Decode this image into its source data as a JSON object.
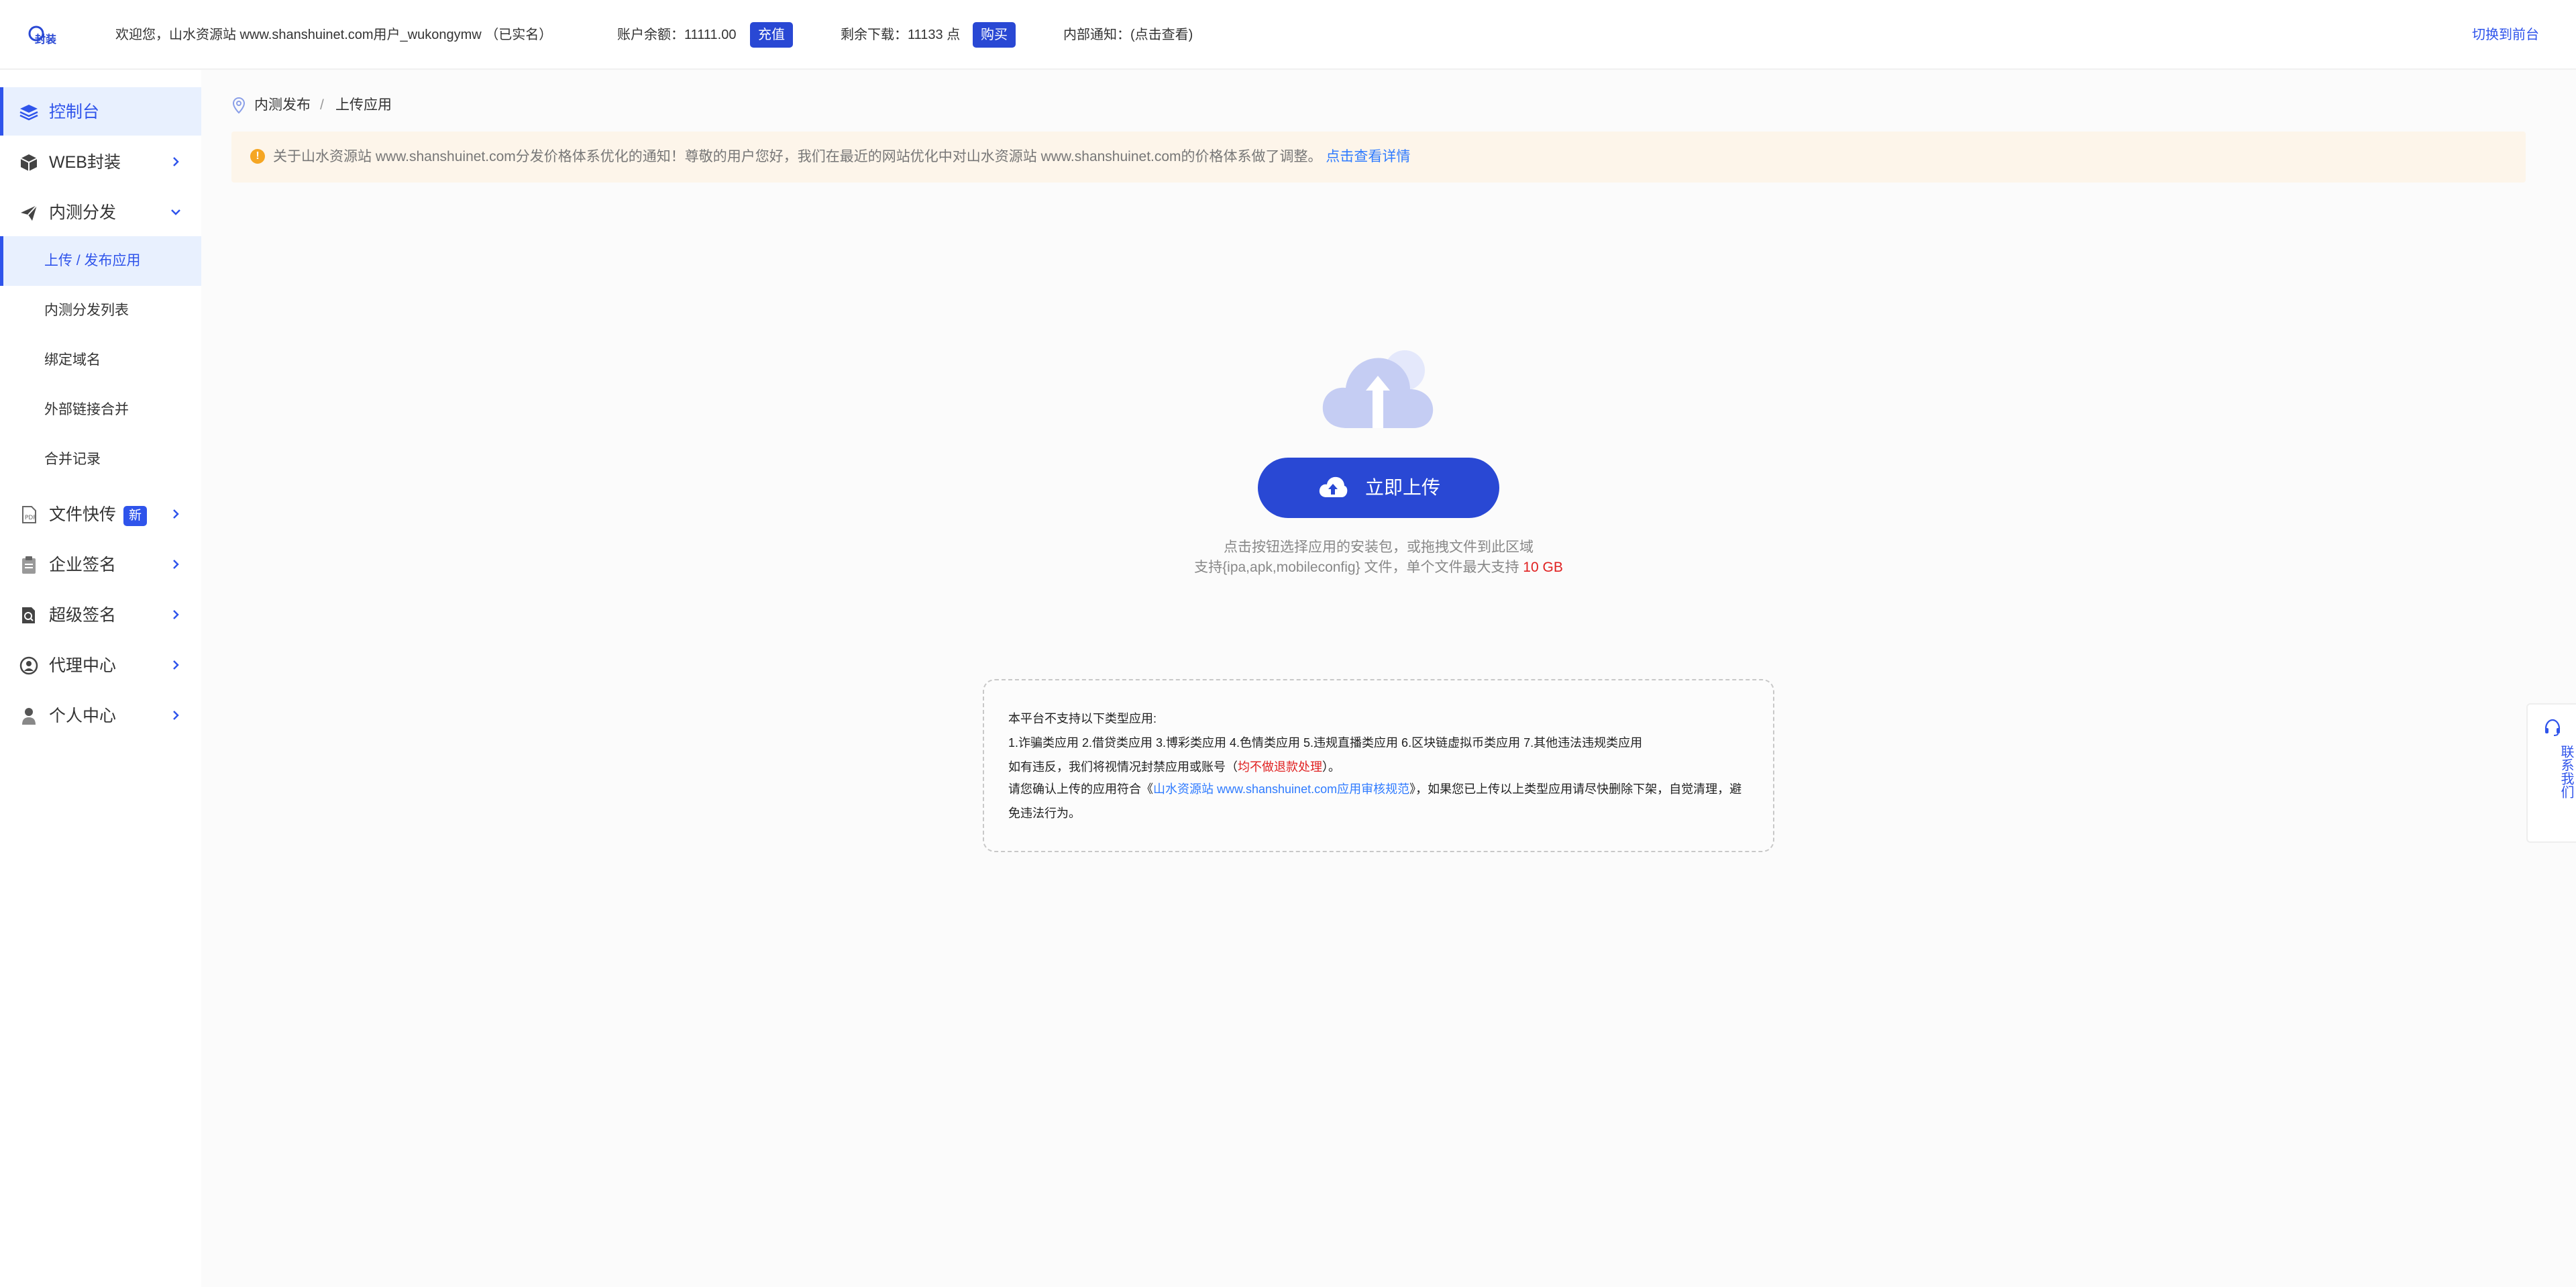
{
  "header": {
    "welcome": "欢迎您，山水资源站 www.shanshuinet.com用户_wukongymw （已实名）",
    "balance_label": "账户余额：11111.00",
    "recharge_button": "充值",
    "downloads_label": "剩余下载：11133 点",
    "buy_button": "购买",
    "notice_label": "内部通知：(点击查看)",
    "switch_link": "切换到前台"
  },
  "sidebar": {
    "items": [
      {
        "label": "控制台",
        "icon": "layers-icon"
      },
      {
        "label": "WEB封装",
        "icon": "box-icon"
      },
      {
        "label": "内测分发",
        "icon": "paper-plane-icon"
      },
      {
        "label": "文件快传",
        "icon": "file-icon",
        "badge": "新"
      },
      {
        "label": "企业签名",
        "icon": "clipboard-icon"
      },
      {
        "label": "超级签名",
        "icon": "document-search-icon"
      },
      {
        "label": "代理中心",
        "icon": "agent-icon"
      },
      {
        "label": "个人中心",
        "icon": "user-icon"
      }
    ],
    "submenu": [
      {
        "label": "上传 / 发布应用"
      },
      {
        "label": "内测分发列表"
      },
      {
        "label": "绑定域名"
      },
      {
        "label": "外部链接合并"
      },
      {
        "label": "合并记录"
      }
    ]
  },
  "breadcrumb": {
    "parent": "内测发布",
    "separator": "/",
    "current": "上传应用"
  },
  "notice": {
    "text": "关于山水资源站 www.shanshuinet.com分发价格体系优化的通知！尊敬的用户您好，我们在最近的网站优化中对山水资源站 www.shanshuinet.com的价格体系做了调整。",
    "link": "点击查看详情"
  },
  "upload": {
    "button": "立即上传",
    "hint1": "点击按钮选择应用的安装包，或拖拽文件到此区域",
    "hint2_prefix": "支持{ipa,apk,mobileconfig} 文件，单个文件最大支持",
    "hint2_size": "10 GB"
  },
  "rules": {
    "title": "本平台不支持以下类型应用:",
    "list": "1.诈骗类应用 2.借贷类应用 3.博彩类应用 4.色情类应用 5.违规直播类应用 6.区块链虚拟币类应用 7.其他违法违规类应用",
    "violation_prefix": "如有违反，我们将视情况封禁应用或账号（",
    "violation_red": "均不做退款处理",
    "violation_suffix": "）。",
    "confirm_prefix": "请您确认上传的应用符合《",
    "confirm_link": "山水资源站 www.shanshuinet.com应用审核规范",
    "confirm_suffix": "》，如果您已上传以上类型应用请尽快删除下架，自觉清理，避免违法行为。"
  },
  "contact": {
    "label": "联系我们",
    "icon": "headset-icon"
  },
  "colors": {
    "primary": "#2948d4",
    "link": "#2f7bff",
    "active_bg": "#e8f0fe",
    "notice_bg": "#fdf5ea",
    "danger": "#e02020"
  }
}
